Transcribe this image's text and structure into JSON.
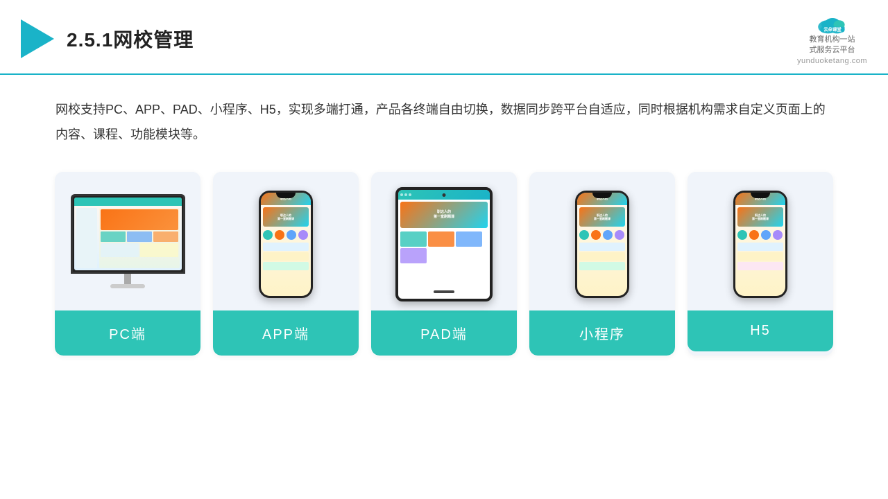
{
  "header": {
    "title": "2.5.1网校管理",
    "logo_main": "云朵课堂",
    "logo_url": "yunduoketang.com",
    "logo_slogan": "教育机构一站\n式服务云平台"
  },
  "description": {
    "text": "网校支持PC、APP、PAD、小程序、H5，实现多端打通，产品各终端自由切换，数据同步跨平台自适应，同时根据机构需求自定义页面上的内容、课程、功能模块等。"
  },
  "cards": [
    {
      "id": "pc",
      "label": "PC端"
    },
    {
      "id": "app",
      "label": "APP端"
    },
    {
      "id": "pad",
      "label": "PAD端"
    },
    {
      "id": "miniprogram",
      "label": "小程序"
    },
    {
      "id": "h5",
      "label": "H5"
    }
  ]
}
